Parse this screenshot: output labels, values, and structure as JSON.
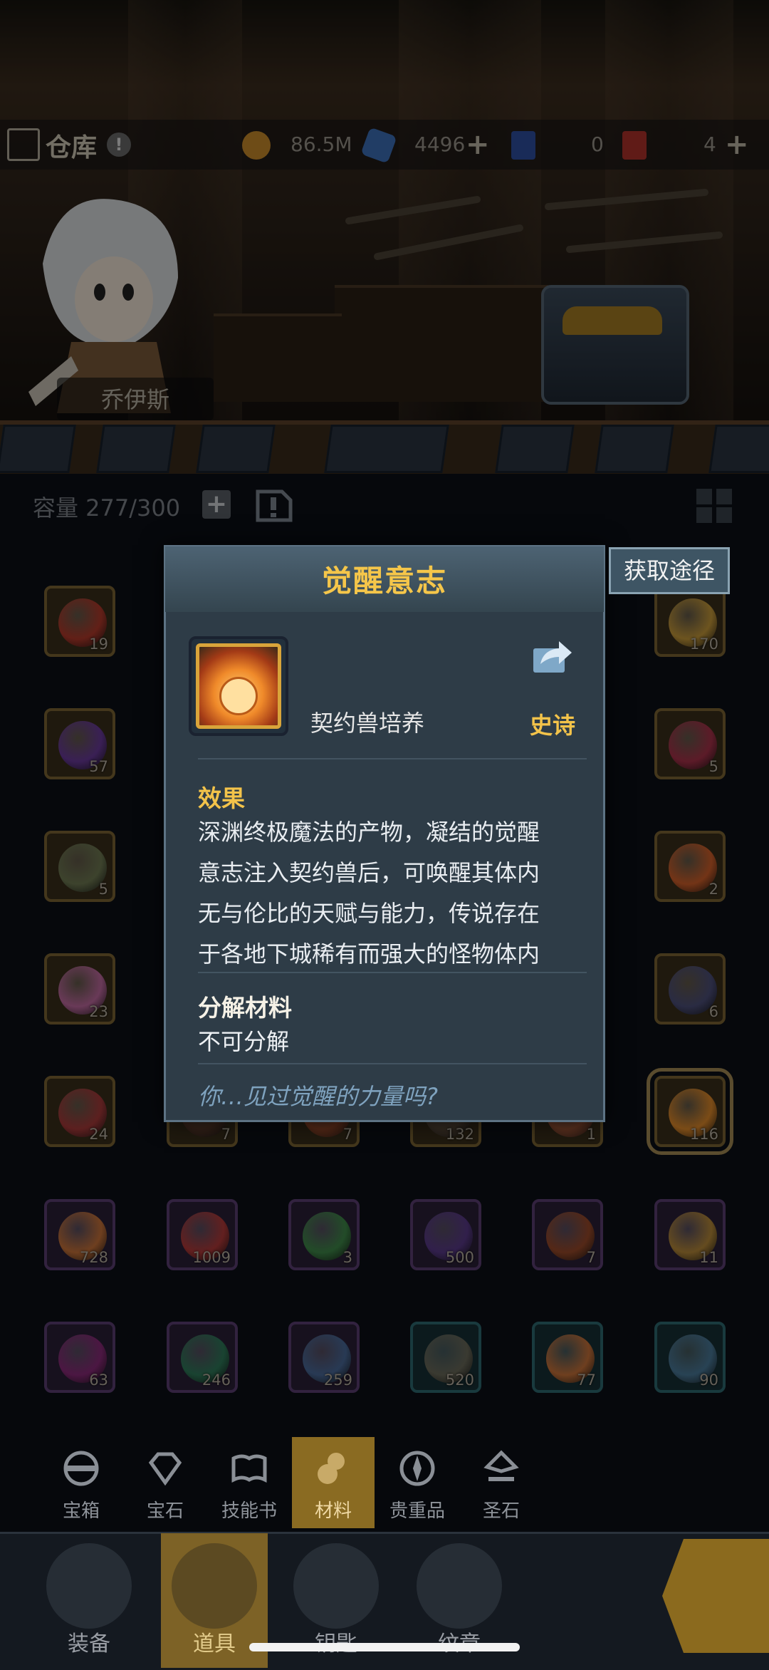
{
  "header": {
    "title": "仓库",
    "info_badge": "!",
    "hero_name": "乔伊斯",
    "currencies": [
      {
        "icon": "gold-coin-icon",
        "value": "86.5M",
        "color": "#c98b2a"
      },
      {
        "icon": "blue-crystal-icon",
        "value": "4496",
        "color": "#3c6fb8",
        "plus": "+"
      },
      {
        "icon": "blue-ticket-icon",
        "value": "0",
        "color": "#2f4fa0"
      },
      {
        "icon": "red-ticket-icon",
        "value": "4",
        "color": "#b0322a",
        "plus": "+"
      }
    ]
  },
  "capacity": {
    "label": "容量 277/300",
    "plus": "+"
  },
  "grid": {
    "rows": [
      [
        {
          "count": "19",
          "rarity": "gold",
          "color": "#b33a2b"
        },
        null,
        null,
        null,
        null,
        {
          "count": "170",
          "rarity": "gold",
          "color": "#c79a3a"
        }
      ],
      [
        {
          "count": "57",
          "rarity": "gold",
          "color": "#6a3a9b"
        },
        null,
        null,
        null,
        null,
        {
          "count": "5",
          "rarity": "gold",
          "color": "#a8324a"
        }
      ],
      [
        {
          "count": "5",
          "rarity": "gold",
          "color": "#6f7a52"
        },
        null,
        null,
        null,
        null,
        {
          "count": "2",
          "rarity": "gold",
          "color": "#d2602a"
        }
      ],
      [
        {
          "count": "23",
          "rarity": "gold",
          "color": "#c06aa0"
        },
        null,
        null,
        null,
        null,
        {
          "count": "6",
          "rarity": "gold",
          "color": "#4d4f7a"
        }
      ],
      [
        {
          "count": "24",
          "rarity": "gold",
          "color": "#a83a3a"
        },
        {
          "count": "7",
          "rarity": "gold",
          "color": "#5a3a2a"
        },
        {
          "count": "7",
          "rarity": "gold",
          "color": "#9a4a2a"
        },
        {
          "count": "132",
          "rarity": "gold",
          "color": "#5a4a3a"
        },
        {
          "count": "1",
          "rarity": "gold",
          "color": "#a85a3a"
        },
        {
          "count": "116",
          "rarity": "gold",
          "color": "#e08a2a",
          "selected": true
        }
      ],
      [
        {
          "count": "728",
          "rarity": "purple",
          "color": "#c9733a"
        },
        {
          "count": "1009",
          "rarity": "purple",
          "color": "#b33a3a"
        },
        {
          "count": "3",
          "rarity": "purple",
          "color": "#3f8a4a"
        },
        {
          "count": "500",
          "rarity": "purple",
          "color": "#5a3a8a"
        },
        {
          "count": "7",
          "rarity": "purple",
          "color": "#9a4a2a"
        },
        {
          "count": "11",
          "rarity": "purple",
          "color": "#b88a3a"
        }
      ],
      [
        {
          "count": "63",
          "rarity": "purple",
          "color": "#8a2a7a"
        },
        {
          "count": "246",
          "rarity": "purple",
          "color": "#2f7a5a"
        },
        {
          "count": "259",
          "rarity": "purple",
          "color": "#4a6a9a"
        },
        {
          "count": "520",
          "rarity": "teal",
          "color": "#6a6a5a"
        },
        {
          "count": "77",
          "rarity": "teal",
          "color": "#c9733a"
        },
        {
          "count": "90",
          "rarity": "teal",
          "color": "#4a7a9a"
        }
      ]
    ]
  },
  "popup": {
    "title": "觉醒意志",
    "source_button": "获取途径",
    "category": "契约兽培养",
    "rarity": "史诗",
    "effect_title": "效果",
    "effect_lines": [
      "深渊终极魔法的产物，凝结的觉醒",
      "意志注入契约兽后，可唤醒其体内",
      "无与伦比的天赋与能力，传说存在",
      "于各地下城稀有而强大的怪物体内"
    ],
    "decompose_title": "分解材料",
    "decompose_text": "不可分解",
    "flavor": "你…见过觉醒的力量吗?"
  },
  "subtabs": [
    {
      "label": "宝箱",
      "icon": "chest-icon",
      "active": false
    },
    {
      "label": "宝石",
      "icon": "gem-icon",
      "active": false
    },
    {
      "label": "技能书",
      "icon": "book-icon",
      "active": false
    },
    {
      "label": "材料",
      "icon": "material-icon",
      "active": true
    },
    {
      "label": "贵重品",
      "icon": "valuable-icon",
      "active": false
    },
    {
      "label": "圣石",
      "icon": "holy-stone-icon",
      "active": false
    }
  ],
  "maintabs": [
    {
      "label": "装备",
      "icon": "equipment-icon",
      "active": false
    },
    {
      "label": "道具",
      "icon": "item-bag-icon",
      "active": true
    },
    {
      "label": "钥匙",
      "icon": "key-icon",
      "active": false
    },
    {
      "label": "纹章",
      "icon": "emblem-icon",
      "active": false
    }
  ]
}
